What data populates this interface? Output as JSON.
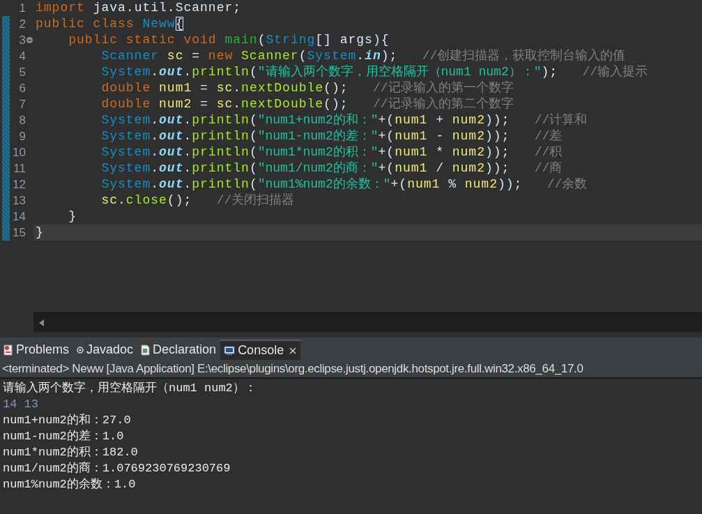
{
  "editor": {
    "lines": [
      {
        "number": "1",
        "changed": false,
        "current": false,
        "foldable": false,
        "tokens": [
          {
            "kind": "keyword",
            "text": "import "
          },
          {
            "kind": "plain",
            "text": "java.util.Scanner;"
          }
        ]
      },
      {
        "number": "2",
        "changed": true,
        "current": false,
        "foldable": false,
        "tokens": [
          {
            "kind": "keyword",
            "text": "public class "
          },
          {
            "kind": "type",
            "text": "Neww"
          },
          {
            "kind": "bracket",
            "text": "{"
          }
        ]
      },
      {
        "number": "3",
        "changed": true,
        "current": false,
        "foldable": true,
        "tokens": [
          {
            "kind": "keyword",
            "text": "    public static void "
          },
          {
            "kind": "decl",
            "text": "main"
          },
          {
            "kind": "plain",
            "text": "("
          },
          {
            "kind": "type",
            "text": "String"
          },
          {
            "kind": "plain",
            "text": "[] args){"
          }
        ]
      },
      {
        "number": "4",
        "changed": true,
        "current": false,
        "foldable": false,
        "tokens": [
          {
            "kind": "type",
            "text": "        Scanner "
          },
          {
            "kind": "var",
            "text": "sc"
          },
          {
            "kind": "plain",
            "text": " = "
          },
          {
            "kind": "keyword",
            "text": "new "
          },
          {
            "kind": "method",
            "text": "Scanner"
          },
          {
            "kind": "plain",
            "text": "("
          },
          {
            "kind": "type",
            "text": "System"
          },
          {
            "kind": "plain",
            "text": "."
          },
          {
            "kind": "field",
            "text": "in"
          },
          {
            "kind": "plain",
            "text": ");   "
          },
          {
            "kind": "comment",
            "text": "//创建扫描器，获取控制台输入的值"
          }
        ]
      },
      {
        "number": "5",
        "changed": true,
        "current": false,
        "foldable": false,
        "tokens": [
          {
            "kind": "type",
            "text": "        System"
          },
          {
            "kind": "plain",
            "text": "."
          },
          {
            "kind": "field",
            "text": "out"
          },
          {
            "kind": "plain",
            "text": "."
          },
          {
            "kind": "method",
            "text": "println"
          },
          {
            "kind": "plain",
            "text": "("
          },
          {
            "kind": "string",
            "text": "\"请输入两个数字，用空格隔开（num1 num2）：\""
          },
          {
            "kind": "plain",
            "text": ");   "
          },
          {
            "kind": "comment",
            "text": "//输入提示"
          }
        ]
      },
      {
        "number": "6",
        "changed": true,
        "current": false,
        "foldable": false,
        "tokens": [
          {
            "kind": "keyword",
            "text": "        double "
          },
          {
            "kind": "var",
            "text": "num1"
          },
          {
            "kind": "plain",
            "text": " = "
          },
          {
            "kind": "var",
            "text": "sc"
          },
          {
            "kind": "plain",
            "text": "."
          },
          {
            "kind": "method",
            "text": "nextDouble"
          },
          {
            "kind": "plain",
            "text": "();   "
          },
          {
            "kind": "comment",
            "text": "//记录输入的第一个数字"
          }
        ]
      },
      {
        "number": "7",
        "changed": true,
        "current": false,
        "foldable": false,
        "tokens": [
          {
            "kind": "keyword",
            "text": "        double "
          },
          {
            "kind": "var",
            "text": "num2"
          },
          {
            "kind": "plain",
            "text": " = "
          },
          {
            "kind": "var",
            "text": "sc"
          },
          {
            "kind": "plain",
            "text": "."
          },
          {
            "kind": "method",
            "text": "nextDouble"
          },
          {
            "kind": "plain",
            "text": "();   "
          },
          {
            "kind": "comment",
            "text": "//记录输入的第二个数字"
          }
        ]
      },
      {
        "number": "8",
        "changed": true,
        "current": false,
        "foldable": false,
        "tokens": [
          {
            "kind": "type",
            "text": "        System"
          },
          {
            "kind": "plain",
            "text": "."
          },
          {
            "kind": "field",
            "text": "out"
          },
          {
            "kind": "plain",
            "text": "."
          },
          {
            "kind": "method",
            "text": "println"
          },
          {
            "kind": "plain",
            "text": "("
          },
          {
            "kind": "string",
            "text": "\"num1+num2的和：\""
          },
          {
            "kind": "plain",
            "text": "+("
          },
          {
            "kind": "var",
            "text": "num1"
          },
          {
            "kind": "plain",
            "text": " + "
          },
          {
            "kind": "var",
            "text": "num2"
          },
          {
            "kind": "plain",
            "text": "));   "
          },
          {
            "kind": "comment",
            "text": "//计算和"
          }
        ]
      },
      {
        "number": "9",
        "changed": true,
        "current": false,
        "foldable": false,
        "tokens": [
          {
            "kind": "type",
            "text": "        System"
          },
          {
            "kind": "plain",
            "text": "."
          },
          {
            "kind": "field",
            "text": "out"
          },
          {
            "kind": "plain",
            "text": "."
          },
          {
            "kind": "method",
            "text": "println"
          },
          {
            "kind": "plain",
            "text": "("
          },
          {
            "kind": "string",
            "text": "\"num1-num2的差：\""
          },
          {
            "kind": "plain",
            "text": "+("
          },
          {
            "kind": "var",
            "text": "num1"
          },
          {
            "kind": "plain",
            "text": " - "
          },
          {
            "kind": "var",
            "text": "num2"
          },
          {
            "kind": "plain",
            "text": "));   "
          },
          {
            "kind": "comment",
            "text": "//差"
          }
        ]
      },
      {
        "number": "10",
        "changed": true,
        "current": false,
        "foldable": false,
        "tokens": [
          {
            "kind": "type",
            "text": "        System"
          },
          {
            "kind": "plain",
            "text": "."
          },
          {
            "kind": "field",
            "text": "out"
          },
          {
            "kind": "plain",
            "text": "."
          },
          {
            "kind": "method",
            "text": "println"
          },
          {
            "kind": "plain",
            "text": "("
          },
          {
            "kind": "string",
            "text": "\"num1*num2的积：\""
          },
          {
            "kind": "plain",
            "text": "+("
          },
          {
            "kind": "var",
            "text": "num1"
          },
          {
            "kind": "plain",
            "text": " * "
          },
          {
            "kind": "var",
            "text": "num2"
          },
          {
            "kind": "plain",
            "text": "));   "
          },
          {
            "kind": "comment",
            "text": "//积"
          }
        ]
      },
      {
        "number": "11",
        "changed": true,
        "current": false,
        "foldable": false,
        "tokens": [
          {
            "kind": "type",
            "text": "        System"
          },
          {
            "kind": "plain",
            "text": "."
          },
          {
            "kind": "field",
            "text": "out"
          },
          {
            "kind": "plain",
            "text": "."
          },
          {
            "kind": "method",
            "text": "println"
          },
          {
            "kind": "plain",
            "text": "("
          },
          {
            "kind": "string",
            "text": "\"num1/num2的商：\""
          },
          {
            "kind": "plain",
            "text": "+("
          },
          {
            "kind": "var",
            "text": "num1"
          },
          {
            "kind": "plain",
            "text": " / "
          },
          {
            "kind": "var",
            "text": "num2"
          },
          {
            "kind": "plain",
            "text": "));   "
          },
          {
            "kind": "comment",
            "text": "//商"
          }
        ]
      },
      {
        "number": "12",
        "changed": true,
        "current": false,
        "foldable": false,
        "tokens": [
          {
            "kind": "type",
            "text": "        System"
          },
          {
            "kind": "plain",
            "text": "."
          },
          {
            "kind": "field",
            "text": "out"
          },
          {
            "kind": "plain",
            "text": "."
          },
          {
            "kind": "method",
            "text": "println"
          },
          {
            "kind": "plain",
            "text": "("
          },
          {
            "kind": "string",
            "text": "\"num1%num2的余数：\""
          },
          {
            "kind": "plain",
            "text": "+("
          },
          {
            "kind": "var",
            "text": "num1"
          },
          {
            "kind": "plain",
            "text": " % "
          },
          {
            "kind": "var",
            "text": "num2"
          },
          {
            "kind": "plain",
            "text": "));   "
          },
          {
            "kind": "comment",
            "text": "//余数"
          }
        ]
      },
      {
        "number": "13",
        "changed": true,
        "current": false,
        "foldable": false,
        "tokens": [
          {
            "kind": "var",
            "text": "        sc"
          },
          {
            "kind": "plain",
            "text": "."
          },
          {
            "kind": "method",
            "text": "close"
          },
          {
            "kind": "plain",
            "text": "();   "
          },
          {
            "kind": "comment",
            "text": "//关闭扫描器"
          }
        ]
      },
      {
        "number": "14",
        "changed": true,
        "current": false,
        "foldable": false,
        "tokens": [
          {
            "kind": "plain",
            "text": "    }"
          }
        ]
      },
      {
        "number": "15",
        "changed": true,
        "current": true,
        "foldable": false,
        "tokens": [
          {
            "kind": "plain",
            "text": "}"
          }
        ]
      }
    ]
  },
  "views": {
    "tabs": [
      {
        "kind": "problems",
        "label": "Problems",
        "selected": false,
        "closable": false
      },
      {
        "kind": "javadoc",
        "label": "Javadoc",
        "selected": false,
        "closable": false
      },
      {
        "kind": "declaration",
        "label": "Declaration",
        "selected": false,
        "closable": false
      },
      {
        "kind": "console",
        "label": "Console",
        "selected": true,
        "closable": true
      }
    ]
  },
  "console": {
    "status": "<terminated> Neww [Java Application] E:\\eclipse\\plugins\\org.eclipse.justj.openjdk.hotspot.jre.full.win32.x86_64_17.0",
    "lines": [
      {
        "kind": "output",
        "text": "请输入两个数字，用空格隔开（num1 num2）："
      },
      {
        "kind": "input",
        "text": "14 13"
      },
      {
        "kind": "output",
        "text": "num1+num2的和：27.0"
      },
      {
        "kind": "output",
        "text": "num1-num2的差：1.0"
      },
      {
        "kind": "output",
        "text": "num1*num2的积：182.0"
      },
      {
        "kind": "output",
        "text": "num1/num2的商：1.0769230769230769"
      },
      {
        "kind": "output",
        "text": "num1%num2的余数：1.0"
      }
    ]
  }
}
